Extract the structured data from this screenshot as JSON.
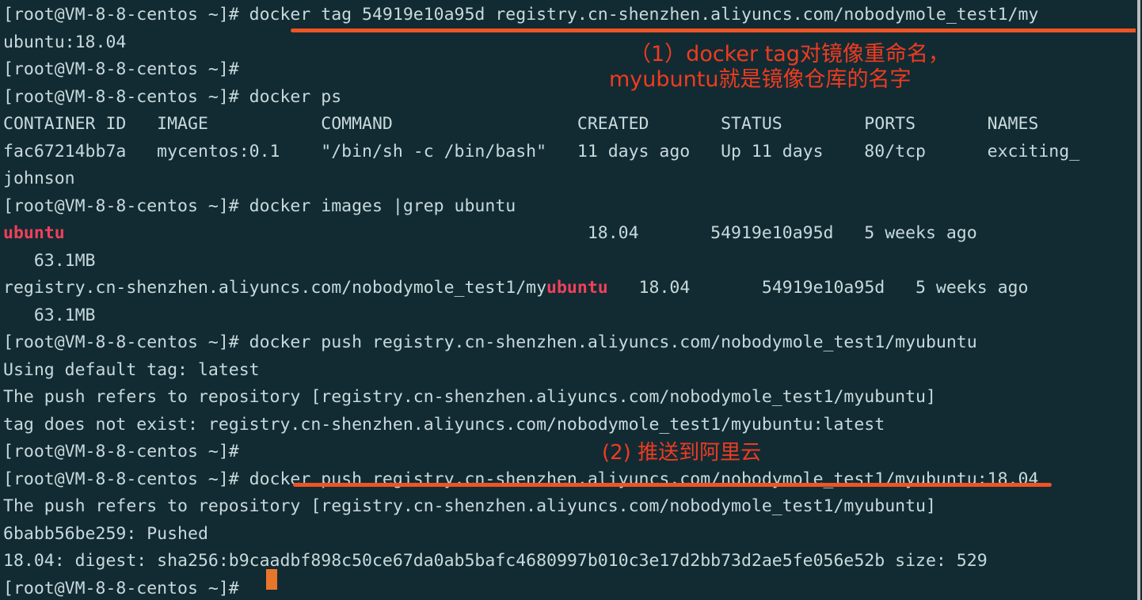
{
  "terminal": {
    "background_color": "#122b33",
    "foreground_color": "#c8d9dc",
    "highlight_color": "#f0405a",
    "annotation_color": "#f03b20",
    "underline_color": "#ef5423",
    "cursor_color": "#e8762a",
    "prompt": "[root@VM-8-8-centos ~]#",
    "lines": [
      {
        "id": "line-01",
        "segments": [
          {
            "text": "[root@VM-8-8-centos ~]# docker tag 54919e10a95d registry.cn-shenzhen.aliyuncs.com/nobodymole_test1/my",
            "style": "normal"
          }
        ]
      },
      {
        "id": "line-02",
        "segments": [
          {
            "text": "ubuntu:18.04",
            "style": "normal"
          }
        ]
      },
      {
        "id": "line-03",
        "segments": [
          {
            "text": "[root@VM-8-8-centos ~]#",
            "style": "normal"
          }
        ]
      },
      {
        "id": "line-04",
        "segments": [
          {
            "text": "[root@VM-8-8-centos ~]# docker ps",
            "style": "normal"
          }
        ]
      },
      {
        "id": "line-05",
        "segments": [
          {
            "text": "CONTAINER ID   IMAGE           COMMAND                  CREATED       STATUS        PORTS       NAMES",
            "style": "normal"
          }
        ]
      },
      {
        "id": "line-06",
        "segments": [
          {
            "text": "fac67214bb7a   mycentos:0.1    \"/bin/sh -c /bin/bash\"   11 days ago   Up 11 days    80/tcp      exciting_",
            "style": "normal"
          }
        ]
      },
      {
        "id": "line-07",
        "segments": [
          {
            "text": "johnson",
            "style": "normal"
          }
        ]
      },
      {
        "id": "line-08",
        "segments": [
          {
            "text": "[root@VM-8-8-centos ~]# docker images |grep ubuntu",
            "style": "normal"
          }
        ]
      },
      {
        "id": "line-09",
        "segments": [
          {
            "text": "ubuntu",
            "style": "highlight"
          },
          {
            "text": "                                                   18.04       54919e10a95d   5 weeks ago",
            "style": "normal"
          }
        ]
      },
      {
        "id": "line-10",
        "segments": [
          {
            "text": "   63.1MB",
            "style": "normal"
          }
        ]
      },
      {
        "id": "line-11",
        "segments": [
          {
            "text": "registry.cn-shenzhen.aliyuncs.com/nobodymole_test1/my",
            "style": "normal"
          },
          {
            "text": "ubuntu",
            "style": "highlight"
          },
          {
            "text": "   18.04       54919e10a95d   5 weeks ago",
            "style": "normal"
          }
        ]
      },
      {
        "id": "line-12",
        "segments": [
          {
            "text": "   63.1MB",
            "style": "normal"
          }
        ]
      },
      {
        "id": "line-13",
        "segments": [
          {
            "text": "[root@VM-8-8-centos ~]# docker push registry.cn-shenzhen.aliyuncs.com/nobodymole_test1/myubuntu",
            "style": "normal"
          }
        ]
      },
      {
        "id": "line-14",
        "segments": [
          {
            "text": "Using default tag: latest",
            "style": "normal"
          }
        ]
      },
      {
        "id": "line-15",
        "segments": [
          {
            "text": "The push refers to repository [registry.cn-shenzhen.aliyuncs.com/nobodymole_test1/myubuntu]",
            "style": "normal"
          }
        ]
      },
      {
        "id": "line-16",
        "segments": [
          {
            "text": "tag does not exist: registry.cn-shenzhen.aliyuncs.com/nobodymole_test1/myubuntu:latest",
            "style": "normal"
          }
        ]
      },
      {
        "id": "line-17",
        "segments": [
          {
            "text": "[root@VM-8-8-centos ~]#",
            "style": "normal"
          }
        ]
      },
      {
        "id": "line-18",
        "segments": [
          {
            "text": "[root@VM-8-8-centos ~]# docker push registry.cn-shenzhen.aliyuncs.com/nobodymole_test1/myubuntu:18.04",
            "style": "normal"
          }
        ]
      },
      {
        "id": "line-19",
        "segments": [
          {
            "text": "The push refers to repository [registry.cn-shenzhen.aliyuncs.com/nobodymole_test1/myubuntu]",
            "style": "normal"
          }
        ]
      },
      {
        "id": "line-20",
        "segments": [
          {
            "text": "6babb56be259: Pushed",
            "style": "normal"
          }
        ]
      },
      {
        "id": "line-21",
        "segments": [
          {
            "text": "18.04: digest: sha256:b9caadbf898c50ce67da0ab5bafc4680997b010c3e17d2bb73d2ae5fe056e52b size: 529",
            "style": "normal"
          }
        ]
      },
      {
        "id": "line-22",
        "segments": [
          {
            "text": "[root@VM-8-8-centos ~]# ",
            "style": "normal"
          }
        ]
      }
    ]
  },
  "annotations": {
    "first": {
      "line1": "（1）docker tag对镜像重命名，",
      "line2": "myubuntu就是镜像仓库的名字"
    },
    "second": {
      "line1": "(2) 推送到阿里云"
    }
  },
  "docker_ps": {
    "headers": [
      "CONTAINER ID",
      "IMAGE",
      "COMMAND",
      "CREATED",
      "STATUS",
      "PORTS",
      "NAMES"
    ],
    "rows": [
      {
        "container_id": "fac67214bb7a",
        "image": "mycentos:0.1",
        "command": "\"/bin/sh -c /bin/bash\"",
        "created": "11 days ago",
        "status": "Up 11 days",
        "ports": "80/tcp",
        "names": "exciting_johnson"
      }
    ]
  },
  "docker_images": {
    "rows": [
      {
        "repository": "ubuntu",
        "tag": "18.04",
        "image_id": "54919e10a95d",
        "created": "5 weeks ago",
        "size": "63.1MB"
      },
      {
        "repository": "registry.cn-shenzhen.aliyuncs.com/nobodymole_test1/myubuntu",
        "tag": "18.04",
        "image_id": "54919e10a95d",
        "created": "5 weeks ago",
        "size": "63.1MB"
      }
    ]
  }
}
